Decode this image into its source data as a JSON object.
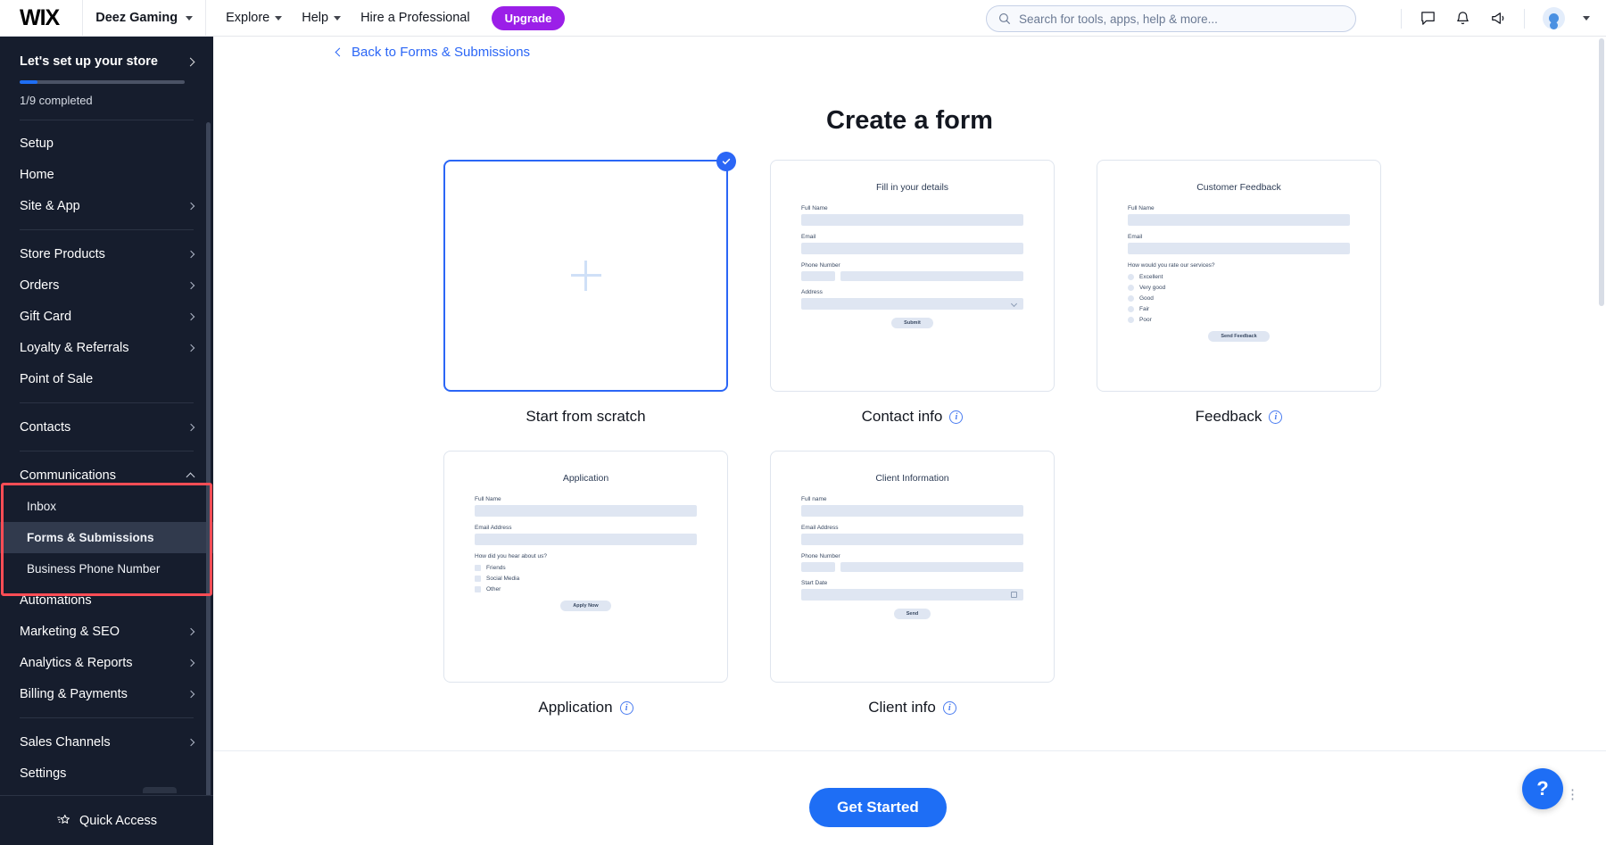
{
  "topbar": {
    "logo": "WIX",
    "site_name": "Deez Gaming",
    "nav": [
      {
        "label": "Explore",
        "has_caret": true
      },
      {
        "label": "Help",
        "has_caret": true
      },
      {
        "label": "Hire a Professional",
        "has_caret": false
      }
    ],
    "upgrade_label": "Upgrade",
    "search": {
      "placeholder": "Search for tools, apps, help & more...",
      "value": ""
    },
    "icons": [
      "chat-icon",
      "bell-icon",
      "megaphone-icon",
      "avatar"
    ]
  },
  "sidebar": {
    "setup": {
      "title": "Let's set up your store",
      "completed_text": "1/9 completed",
      "progress_percent": 11
    },
    "items": [
      {
        "label": "Setup",
        "chevron": "none",
        "level": 0
      },
      {
        "label": "Home",
        "chevron": "none",
        "level": 0
      },
      {
        "label": "Site & App",
        "chevron": "right",
        "level": 0
      },
      {
        "label": "Store Products",
        "chevron": "right",
        "level": 0
      },
      {
        "label": "Orders",
        "chevron": "right",
        "level": 0
      },
      {
        "label": "Gift Card",
        "chevron": "right",
        "level": 0
      },
      {
        "label": "Loyalty & Referrals",
        "chevron": "right",
        "level": 0
      },
      {
        "label": "Point of Sale",
        "chevron": "none",
        "level": 0
      },
      {
        "label": "Contacts",
        "chevron": "right",
        "level": 0
      },
      {
        "label": "Communications",
        "chevron": "up",
        "level": 0
      },
      {
        "label": "Inbox",
        "chevron": "none",
        "level": 1
      },
      {
        "label": "Forms & Submissions",
        "chevron": "none",
        "level": 1,
        "active": true
      },
      {
        "label": "Business Phone Number",
        "chevron": "none",
        "level": 1
      },
      {
        "label": "Automations",
        "chevron": "none",
        "level": 0
      },
      {
        "label": "Marketing & SEO",
        "chevron": "right",
        "level": 0
      },
      {
        "label": "Analytics & Reports",
        "chevron": "right",
        "level": 0
      },
      {
        "label": "Billing & Payments",
        "chevron": "right",
        "level": 0
      },
      {
        "label": "Sales Channels",
        "chevron": "right",
        "level": 0
      },
      {
        "label": "Settings",
        "chevron": "none",
        "level": 0
      }
    ],
    "quick_access": "Quick Access",
    "highlight_color": "#ff4d55"
  },
  "main": {
    "back_link": "Back to Forms & Submissions",
    "page_title": "Create a form",
    "get_started": "Get Started",
    "help_label": "?",
    "cards": [
      {
        "label": "Start from scratch",
        "selected": true,
        "has_info": false,
        "preview": {
          "kind": "scratch"
        }
      },
      {
        "label": "Contact info",
        "selected": false,
        "has_info": true,
        "preview": {
          "kind": "form",
          "title": "Fill in your details",
          "fields": [
            {
              "label": "Full Name",
              "type": "text"
            },
            {
              "label": "Email",
              "type": "text"
            },
            {
              "label": "Phone Number",
              "type": "phone"
            },
            {
              "label": "Address",
              "type": "select"
            }
          ],
          "button": "Submit"
        }
      },
      {
        "label": "Feedback",
        "selected": false,
        "has_info": true,
        "preview": {
          "kind": "form",
          "title": "Customer Feedback",
          "fields": [
            {
              "label": "Full Name",
              "type": "text"
            },
            {
              "label": "Email",
              "type": "text"
            }
          ],
          "question": "How would you rate our services?",
          "option_type": "radio",
          "options": [
            "Excellent",
            "Very good",
            "Good",
            "Fair",
            "Poor"
          ],
          "button": "Send Feedback"
        }
      },
      {
        "label": "Application",
        "selected": false,
        "has_info": true,
        "preview": {
          "kind": "form",
          "title": "Application",
          "fields": [
            {
              "label": "Full Name",
              "type": "text"
            },
            {
              "label": "Email Address",
              "type": "text"
            }
          ],
          "question": "How did you hear about us?",
          "option_type": "checkbox",
          "options": [
            "Friends",
            "Social Media",
            "Other"
          ],
          "button": "Apply Now"
        }
      },
      {
        "label": "Client info",
        "selected": false,
        "has_info": true,
        "preview": {
          "kind": "form",
          "title": "Client Information",
          "fields": [
            {
              "label": "Full name",
              "type": "text"
            },
            {
              "label": "Email Address",
              "type": "text"
            },
            {
              "label": "Phone Number",
              "type": "phone"
            },
            {
              "label": "Start Date",
              "type": "date"
            }
          ],
          "button": "Send"
        }
      }
    ]
  },
  "colors": {
    "accent_blue": "#1e6ef5",
    "link_blue": "#2b66f6",
    "upgrade_purple": "#9b1fe8",
    "sidebar_bg": "#161d2d",
    "highlight_red": "#ff4d55"
  }
}
